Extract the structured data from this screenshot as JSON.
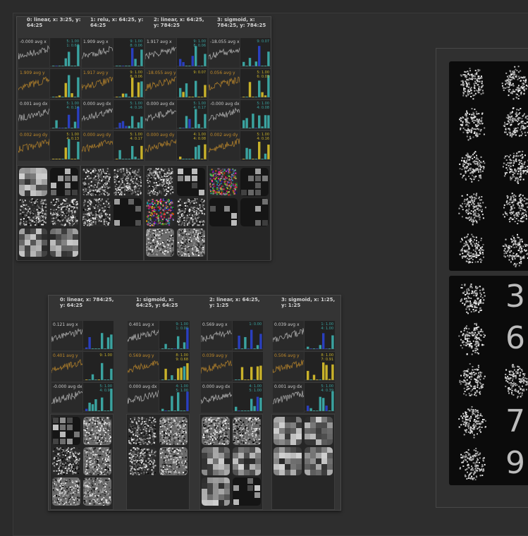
{
  "panel_top": {
    "layers": [
      {
        "title": "0: linear, x: 3:25, y: 64:25",
        "rows": [
          {
            "label": "-0.000  avg x",
            "hist": "5: 1.00\n1: 0.67",
            "kind": "x"
          },
          {
            "label": "1.909  avg y",
            "hist": "",
            "kind": "y"
          },
          {
            "label": "0.001  avg dx",
            "hist": "5: 1.00\n4: 0.14",
            "kind": "x"
          },
          {
            "label": "0.002  avg dy",
            "hist": "5: 1.00\n4: 0.13",
            "kind": "y"
          }
        ]
      },
      {
        "title": "1: relu, x: 64:25, y: 64:25",
        "rows": [
          {
            "label": "1.909  avg x",
            "hist": "9: 1.00\n8: 0.06",
            "kind": "x"
          },
          {
            "label": "1.917  avg y",
            "hist": "9: 1.00\n8: 0.06",
            "kind": "y"
          },
          {
            "label": "0.000  avg dx",
            "hist": "5: 1.00\n4: 0.16",
            "kind": "x"
          },
          {
            "label": "0.000  avg dy",
            "hist": "5: 1.00\n4: 0.17",
            "kind": "y"
          }
        ]
      },
      {
        "title": "2: linear, x: 64:25, y: 784:25",
        "rows": [
          {
            "label": "1.917  avg x",
            "hist": "9: 1.00\n8: 0.06",
            "kind": "x"
          },
          {
            "label": "-18.055  avg y",
            "hist": "9: 0.07",
            "kind": "y"
          },
          {
            "label": "0.000  avg dx",
            "hist": "5: 1.00\n4: 0.17",
            "kind": "x"
          },
          {
            "label": "0.000  avg dy",
            "hist": "4: 1.00\n4: 0.08",
            "kind": "y"
          }
        ]
      },
      {
        "title": "3: sigmoid, x: 784:25, y: 784:25",
        "rows": [
          {
            "label": "-18.055  avg x",
            "hist": "9: 0.07",
            "kind": "x"
          },
          {
            "label": "0.056  avg y",
            "hist": "5: 1.00\n6: 0.03",
            "kind": "y"
          },
          {
            "label": "-0.000  avg dx",
            "hist": "5: 1.00\n4: 0.08",
            "kind": "x"
          },
          {
            "label": "0.002  avg dy",
            "hist": "5: 1.00\n4: 0.16",
            "kind": "y"
          }
        ]
      }
    ]
  },
  "panel_bottom": {
    "layers": [
      {
        "title": "0: linear, x: 784:25, y: 64:25",
        "rows": [
          {
            "label": "0.121  avg x",
            "hist": "",
            "kind": "x"
          },
          {
            "label": "0.401  avg y",
            "hist": "9: 1.00",
            "kind": "y"
          },
          {
            "label": "-0.000  avg dx",
            "hist": "5: 1.00\n4: 0.95",
            "kind": "x"
          },
          {
            "label": "0.000  avg dy",
            "hist": "4: 1.00\n5: 1.00",
            "kind": "y"
          }
        ]
      },
      {
        "title": "1: sigmoid, x: 64:25, y: 64:25",
        "rows": [
          {
            "label": "0.401  avg x",
            "hist": "9: 1.00\n1: 0.00",
            "kind": "x"
          },
          {
            "label": "0.569  avg y",
            "hist": "8: 1.00\n9: 0.68",
            "kind": "y"
          },
          {
            "label": "0.000  avg dx",
            "hist": "4: 1.00\n5: 1.00",
            "kind": "x"
          },
          {
            "label": "0.000  avg dy",
            "hist": "4: 1.00\n5: 1.00",
            "kind": "y"
          }
        ]
      },
      {
        "title": "2: linear, x: 64:25, y: 1:25",
        "rows": [
          {
            "label": "0.569  avg x",
            "hist": "1: 0.00",
            "kind": "x"
          },
          {
            "label": "0.039  avg y",
            "hist": "",
            "kind": "y"
          },
          {
            "label": "0.000  avg dx",
            "hist": "4: 1.00\n5: 1.00",
            "kind": "x"
          },
          {
            "label": "0.001  avg dy",
            "hist": "4: 1.00\n6: 0.39",
            "kind": "y"
          }
        ]
      },
      {
        "title": "3: sigmoid, x: 1:25, y: 1:25",
        "rows": [
          {
            "label": "0.039  avg x",
            "hist": "1: 1.00\n4: 1.00",
            "kind": "x"
          },
          {
            "label": "0.506  avg y",
            "hist": "8: 1.00\n7: 0.91",
            "kind": "y"
          },
          {
            "label": "0.001  avg dx",
            "hist": "5: 1.00\n4: 0.39",
            "kind": "x"
          },
          {
            "label": "0.010  avg dy",
            "hist": "1: 1.00\n7: 0.64",
            "kind": "y"
          }
        ]
      }
    ]
  },
  "digits": {
    "bottom_right": [
      "3",
      "6",
      "",
      "7",
      "9"
    ]
  },
  "colors": {
    "accent_x": "#3aa3a0",
    "accent_y": "#c9b22a",
    "spark_x": "#bdbdbd",
    "spark_y": "#c08a2a",
    "hist_blue": "#2a3fbf"
  }
}
